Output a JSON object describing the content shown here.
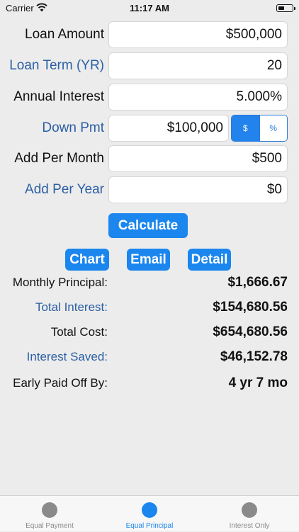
{
  "status_bar": {
    "carrier": "Carrier",
    "time": "11:17 AM"
  },
  "form": {
    "loan_amount": {
      "label": "Loan Amount",
      "value": "$500,000"
    },
    "loan_term": {
      "label": "Loan Term (YR)",
      "value": "20"
    },
    "annual_interest": {
      "label": "Annual Interest",
      "value": "5.000%"
    },
    "down_pmt": {
      "label": "Down Pmt",
      "value": "$100,000",
      "mode_options": [
        "$",
        "%"
      ],
      "selected_mode": "$"
    },
    "add_per_month": {
      "label": "Add Per Month",
      "value": "$500"
    },
    "add_per_year": {
      "label": "Add Per Year",
      "value": "$0"
    }
  },
  "buttons": {
    "calculate": "Calculate",
    "chart": "Chart",
    "email": "Email",
    "detail": "Detail"
  },
  "results": [
    {
      "label": "Monthly Principal:",
      "value": "$1,666.67"
    },
    {
      "label": "Total Interest:",
      "value": "$154,680.56"
    },
    {
      "label": "Total Cost:",
      "value": "$654,680.56"
    },
    {
      "label": "Interest Saved:",
      "value": "$46,152.78"
    },
    {
      "label": "Early Paid Off By:",
      "value": "4 yr 7 mo"
    }
  ],
  "tabs": [
    {
      "label": "Equal Payment",
      "active": false
    },
    {
      "label": "Equal Principal",
      "active": true
    },
    {
      "label": "Interest Only",
      "active": false
    }
  ],
  "colors": {
    "accent": "#1a86ee",
    "label_blue": "#2b5fa3",
    "background": "#ececec"
  }
}
